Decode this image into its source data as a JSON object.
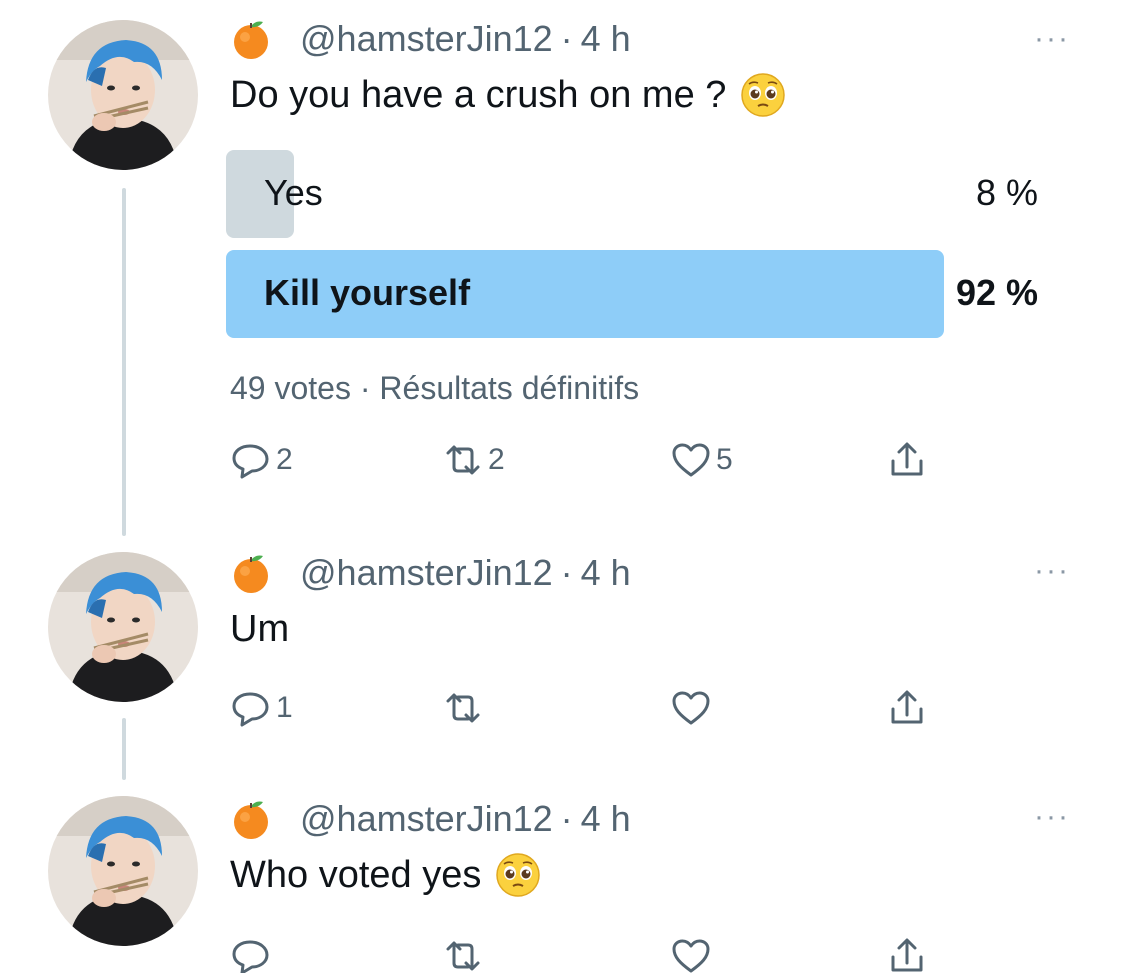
{
  "tweets": [
    {
      "handle": "@hamsterJin12",
      "separator": "·",
      "time": "4 h",
      "text": "Do you have a crush on me ?",
      "text_emoji": "pleading-face-icon",
      "poll": {
        "options": [
          {
            "label": "Yes",
            "percent_text": "8 %",
            "fraction": 0.08,
            "winner": false,
            "color": "#cfd9de"
          },
          {
            "label": "Kill yourself",
            "percent_text": "92 %",
            "fraction": 0.92,
            "winner": true,
            "color": "#8ecdf8"
          }
        ],
        "votes": "49 votes",
        "separator": "·",
        "status": "Résultats définitifs"
      },
      "actions": {
        "reply_count": "2",
        "retweet_count": "2",
        "like_count": "5",
        "share_count": ""
      }
    },
    {
      "handle": "@hamsterJin12",
      "separator": "·",
      "time": "4 h",
      "text": "Um",
      "actions": {
        "reply_count": "1",
        "retweet_count": "",
        "like_count": "",
        "share_count": ""
      }
    },
    {
      "handle": "@hamsterJin12",
      "separator": "·",
      "time": "4 h",
      "text": "Who voted yes",
      "text_emoji": "pleading-face-icon",
      "actions": {
        "reply_count": "",
        "retweet_count": "",
        "like_count": "",
        "share_count": ""
      }
    }
  ],
  "more_menu": "···",
  "icons": {
    "name_emoji": "tangerine-icon",
    "more": "more-options-icon"
  },
  "colors": {
    "secondary_text": "#536471",
    "thread_line": "#cfd9de",
    "poll_winner": "#8ecdf8",
    "poll_other": "#cfd9de"
  }
}
